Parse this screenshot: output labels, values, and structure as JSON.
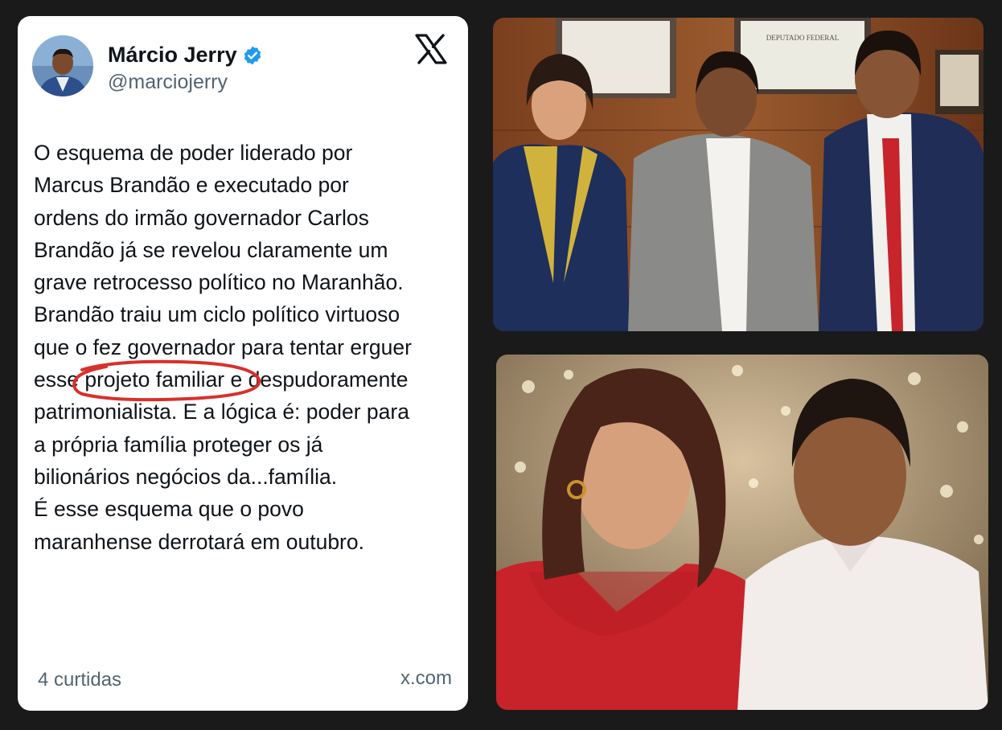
{
  "tweet": {
    "author_name": "Márcio Jerry",
    "handle": "@marciojerry",
    "verified": true,
    "platform_icon": "x-logo-icon",
    "body_lines": [
      "O esquema de poder liderado por",
      "Marcus Brandão e executado por",
      "ordens do irmão governador Carlos",
      "Brandão já se revelou claramente um",
      "grave retrocesso político no Maranhão.",
      "Brandão traiu um ciclo político virtuoso",
      "que o fez governador para tentar erguer",
      "esse projeto familiar e despudoramente",
      "patrimonialista. E a lógica é: poder para",
      "a própria família proteger os já",
      "bilionários negócios da...família.",
      "É esse esquema que o povo",
      "maranhense derrotará em outubro."
    ],
    "highlighted_phrase": "projeto familiar",
    "likes": "4 curtidas",
    "source": "x.com",
    "colors": {
      "verified_badge": "#1d9bf0",
      "highlight_circle": "#d9302b",
      "secondary_text": "#536471"
    }
  },
  "photos": {
    "top": {
      "plaque_text": "DEPUTADO FEDERAL"
    },
    "bottom": {}
  }
}
